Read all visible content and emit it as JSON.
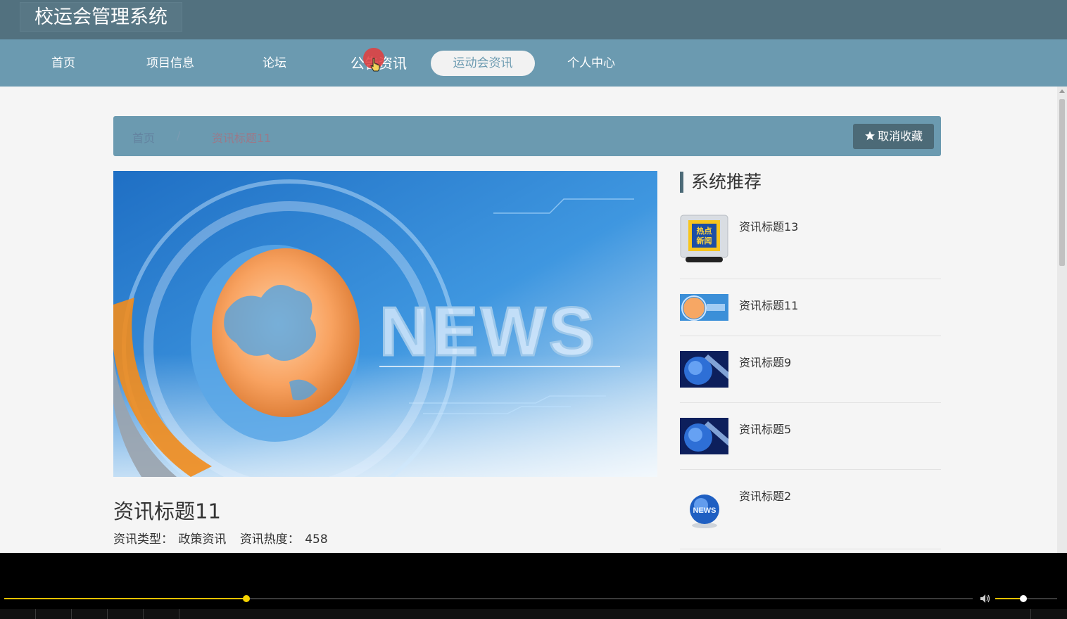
{
  "app": {
    "title": "校运会管理系统"
  },
  "nav": {
    "items": [
      {
        "label": "首页"
      },
      {
        "label": "项目信息"
      },
      {
        "label": "论坛"
      },
      {
        "label": "公告资讯"
      },
      {
        "label": "运动会资讯"
      },
      {
        "label": "个人中心"
      }
    ],
    "active_index": 4
  },
  "breadcrumb": {
    "home": "首页",
    "separator": "/",
    "current": "资讯标题11"
  },
  "favorite_button": {
    "label": "取消收藏",
    "icon": "star-icon"
  },
  "article": {
    "title": "资讯标题11",
    "hero_text": "NEWS",
    "type_label": "资讯类型：",
    "type_value": "政策资讯",
    "heat_label": "资讯热度：",
    "heat_value": "458"
  },
  "sidebar": {
    "heading": "系统推荐",
    "items": [
      {
        "title": "资讯标题13",
        "thumb": "hot-news-tv-icon",
        "thumb_text": "热点新闻"
      },
      {
        "title": "资讯标题11",
        "thumb": "news-globe-banner"
      },
      {
        "title": "资讯标题9",
        "thumb": "blue-globe-thumb"
      },
      {
        "title": "资讯标题5",
        "thumb": "blue-globe-thumb"
      },
      {
        "title": "资讯标题2",
        "thumb": "news-globe-icon",
        "thumb_text": "NEWS"
      }
    ]
  },
  "player": {
    "progress": 0.25,
    "volume": 0.45
  },
  "colors": {
    "header": "#52717f",
    "nav": "#6b9ab0",
    "accent_button": "#4c6a77",
    "progress": "#e6c200"
  }
}
